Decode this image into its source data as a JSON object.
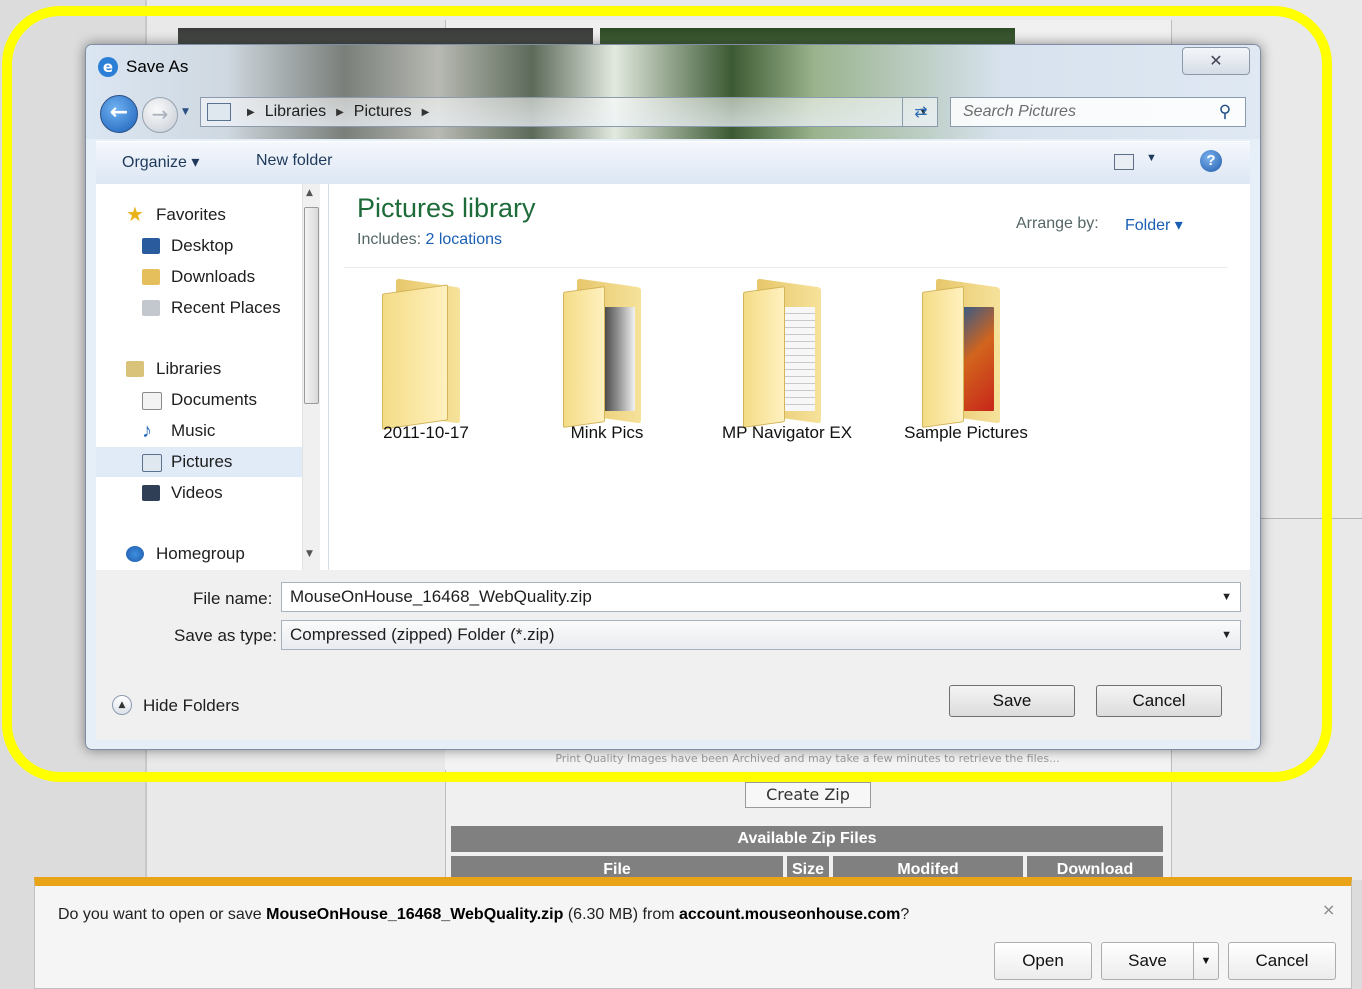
{
  "background": {
    "archive_note": "Print Quality Images have been Archived and may take a few minutes to retrieve the files...",
    "create_zip": "Create Zip",
    "zip_table_title": "Available Zip Files",
    "zip_columns": [
      "File",
      "Size",
      "Modifed",
      "Download"
    ]
  },
  "dialog": {
    "title": "Save As",
    "close_glyph": "✕",
    "address": {
      "segments": [
        "Libraries",
        "Pictures"
      ]
    },
    "search_placeholder": "Search Pictures",
    "toolbar": {
      "organize": "Organize ▾",
      "new_folder": "New folder"
    },
    "nav": {
      "favorites": "Favorites",
      "desktop": "Desktop",
      "downloads": "Downloads",
      "recent_places": "Recent Places",
      "libraries": "Libraries",
      "documents": "Documents",
      "music": "Music",
      "pictures": "Pictures",
      "videos": "Videos",
      "homegroup": "Homegroup"
    },
    "library": {
      "title": "Pictures library",
      "includes_label": "Includes:",
      "includes_link": "2 locations",
      "arrange_by_label": "Arrange by:",
      "arrange_by_value": "Folder ▾"
    },
    "folders": [
      {
        "name": "2011-10-17"
      },
      {
        "name": "Mink Pics"
      },
      {
        "name": "MP Navigator EX"
      },
      {
        "name": "Sample Pictures"
      }
    ],
    "file_name_label": "File name:",
    "file_name_value": "MouseOnHouse_16468_WebQuality.zip",
    "save_type_label": "Save as type:",
    "save_type_value": "Compressed (zipped) Folder (*.zip)",
    "hide_folders": "Hide Folders",
    "save_button": "Save",
    "cancel_button": "Cancel"
  },
  "notification": {
    "prefix": "Do you want to open or save ",
    "filename": "MouseOnHouse_16468_WebQuality.zip",
    "size": " (6.30 MB) from ",
    "site": "account.mouseonhouse.com",
    "suffix": "?",
    "open_button": "Open",
    "save_button": "Save",
    "cancel_button": "Cancel",
    "close_glyph": "×"
  },
  "colors": {
    "highlight": "#ffff00",
    "notification_accent": "#e8a316",
    "library_title": "#1e6b3a",
    "link": "#1a5fb4"
  }
}
